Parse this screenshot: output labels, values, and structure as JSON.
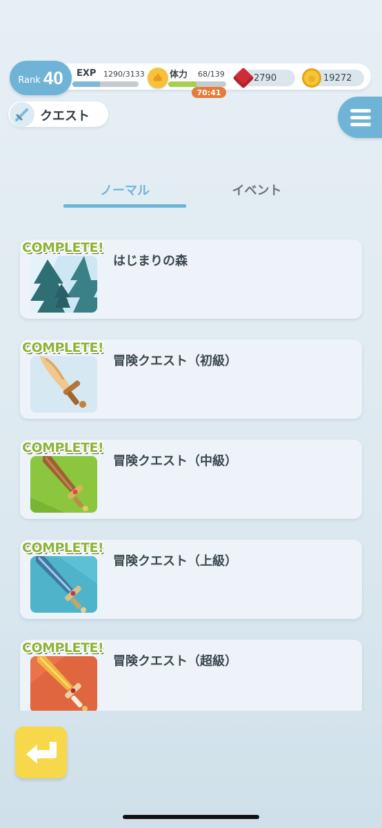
{
  "header": {
    "rank_label": "Rank",
    "rank_value": "40",
    "exp": {
      "label": "EXP",
      "value_text": "1290/3133",
      "current": 1290,
      "max": 3133
    },
    "stamina": {
      "label": "体力",
      "value_text": "68/139",
      "current": 68,
      "max": 139,
      "timer": "70:41"
    },
    "gems": "2790",
    "coins": "19272"
  },
  "page": {
    "title": "クエスト"
  },
  "tabs": [
    {
      "label": "ノーマル",
      "active": true
    },
    {
      "label": "イベント",
      "active": false
    }
  ],
  "quests": [
    {
      "name": "はじまりの森",
      "badge": "COMPLETE!",
      "thumbnail": "forest"
    },
    {
      "name": "冒険クエスト（初級）",
      "badge": "COMPLETE!",
      "thumbnail": "wooden-sword"
    },
    {
      "name": "冒険クエスト（中級）",
      "badge": "COMPLETE!",
      "thumbnail": "bronze-sword"
    },
    {
      "name": "冒険クエスト（上級）",
      "badge": "COMPLETE!",
      "thumbnail": "steel-sword"
    },
    {
      "name": "冒険クエスト（超級）",
      "badge": "COMPLETE!",
      "thumbnail": "golden-sword"
    }
  ],
  "colors": {
    "accent": "#6fb4d6",
    "complete_badge": "#8db43a",
    "timer": "#e67a37",
    "back_button": "#f7d84a"
  },
  "icons": {
    "menu": "hamburger-icon",
    "back": "back-arrow-icon",
    "title": "sword-icon",
    "gem": "red-gem-icon",
    "coin": "gold-coin-icon",
    "stamina": "muscle-arm-icon"
  }
}
